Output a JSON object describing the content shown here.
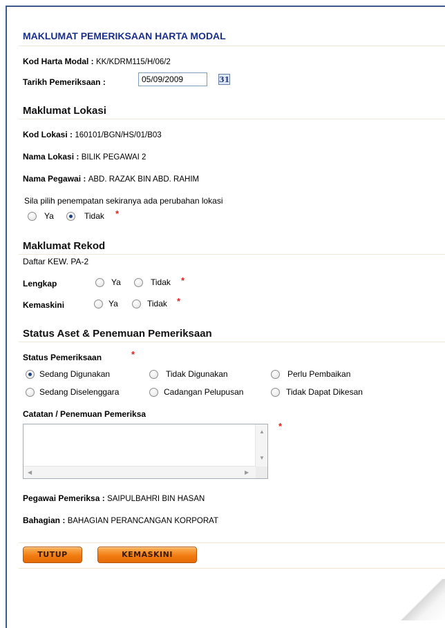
{
  "page_title": "MAKLUMAT PEMERIKSAAN HARTA MODAL",
  "kod_harta": {
    "label": "Kod Harta Modal :",
    "value": "KK/KDRM115/H/06/2"
  },
  "tarikh": {
    "label": "Tarikh Pemeriksaan :",
    "value": "05/09/2009",
    "calendar_text": "31"
  },
  "lokasi": {
    "heading": "Maklumat Lokasi",
    "kod_label": "Kod Lokasi :",
    "kod_value": "160101/BGN/HS/01/B03",
    "nama_label": "Nama Lokasi :",
    "nama_value": "BILIK PEGAWAI 2",
    "pegawai_label": "Nama Pegawai :",
    "pegawai_value": "ABD. RAZAK BIN ABD. RAHIM",
    "prompt": "Sila pilih penempatan sekiranya ada perubahan lokasi",
    "opt_ya": "Ya",
    "opt_tidak": "Tidak",
    "selected": "Tidak"
  },
  "rekod": {
    "heading": "Maklumat Rekod",
    "sub": "Daftar KEW. PA-2",
    "lengkap_label": "Lengkap",
    "kemaskini_label": "Kemaskini",
    "opt_ya": "Ya",
    "opt_tidak": "Tidak"
  },
  "status": {
    "heading": "Status Aset & Penemuan Pemeriksaan",
    "label": "Status Pemeriksaan",
    "options": [
      "Sedang Digunakan",
      "Tidak Digunakan",
      "Perlu Pembaikan",
      "Sedang Diselenggara",
      "Cadangan Pelupusan",
      "Tidak Dapat Dikesan"
    ],
    "selected": "Sedang Digunakan"
  },
  "catatan": {
    "label": "Catatan / Penemuan Pemeriksa",
    "value": ""
  },
  "pemeriksa": {
    "label": "Pegawai Pemeriksa :",
    "value": "SAIPULBAHRI BIN HASAN"
  },
  "bahagian": {
    "label": "Bahagian :",
    "value": "BAHAGIAN PERANCANGAN KORPORAT"
  },
  "required_mark": "*",
  "buttons": {
    "tutup": "TUTUP",
    "kemaskini": "KEMASKINI"
  },
  "colors": {
    "title": "#1a2f8c",
    "required": "#e02020",
    "button": "#f27d12",
    "frame": "#3d5a8a"
  }
}
